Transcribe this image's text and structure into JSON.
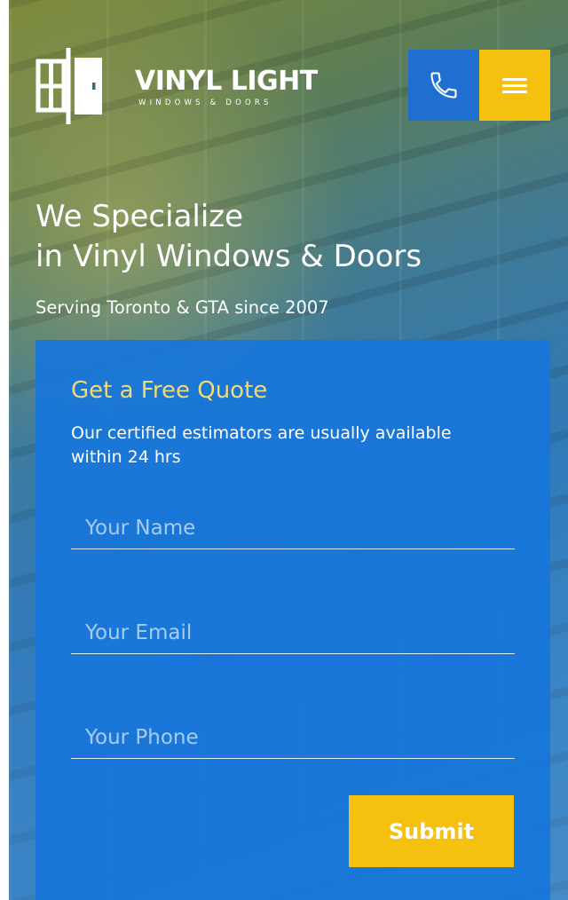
{
  "brand": {
    "title": "VINYL LIGHT",
    "subtitle": "WINDOWS & DOORS"
  },
  "header": {
    "phone_icon": "phone-icon",
    "menu_icon": "hamburger-menu-icon"
  },
  "hero": {
    "headline_line1": "We Specialize",
    "headline_line2": "in Vinyl Windows & Doors",
    "tagline": "Serving Toronto & GTA since 2007"
  },
  "quote_form": {
    "title": "Get a Free Quote",
    "description": "Our certified estimators are usually available within 24 hrs",
    "name_placeholder": "Your Name",
    "email_placeholder": "Your Email",
    "phone_placeholder": "Your Phone",
    "submit_label": "Submit"
  },
  "colors": {
    "primary_blue": "#1f6fd1",
    "accent_yellow": "#f5c00e",
    "quote_title": "#f2d978"
  }
}
